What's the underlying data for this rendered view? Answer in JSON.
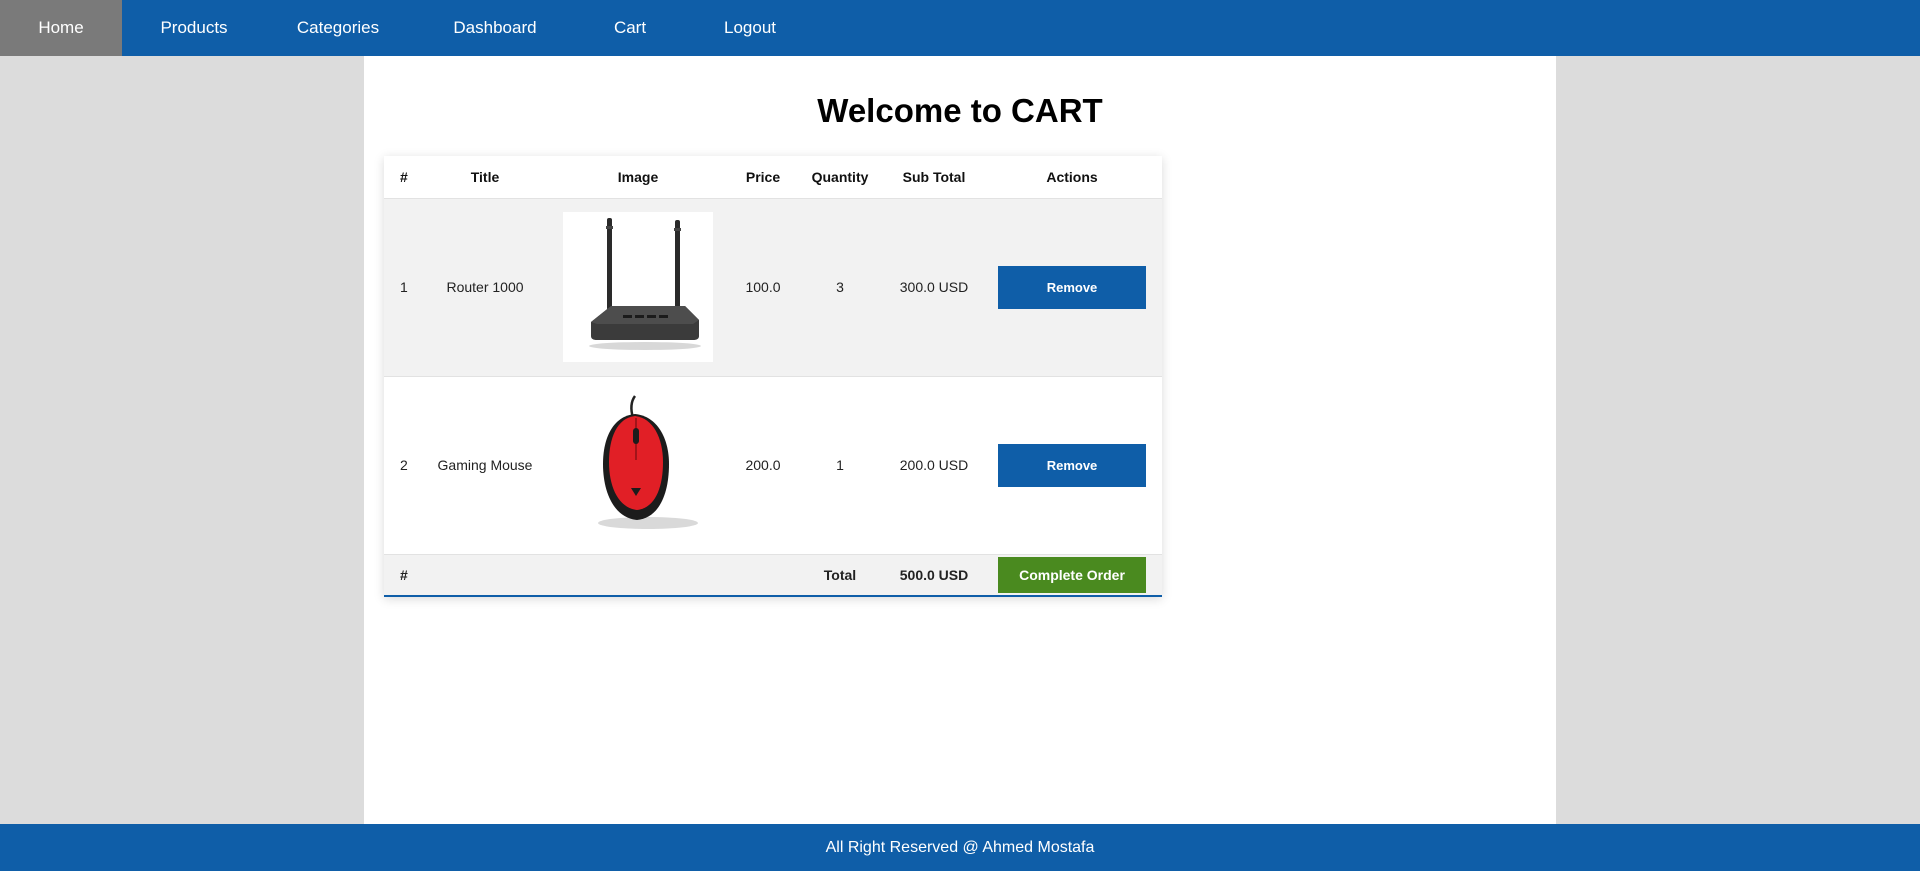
{
  "nav": {
    "items": [
      {
        "label": "Home",
        "active": true
      },
      {
        "label": "Products",
        "active": false
      },
      {
        "label": "Categories",
        "active": false
      },
      {
        "label": "Dashboard",
        "active": false
      },
      {
        "label": "Cart",
        "active": false
      },
      {
        "label": "Logout",
        "active": false
      }
    ]
  },
  "page": {
    "title": "Welcome to CART"
  },
  "cart": {
    "headers": [
      "#",
      "Title",
      "Image",
      "Price",
      "Quantity",
      "Sub Total",
      "Actions"
    ],
    "rows": [
      {
        "index": "1",
        "title": "Router 1000",
        "image": "router-image",
        "price": "100.0",
        "quantity": "3",
        "subtotal": "300.0 USD",
        "action_label": "Remove"
      },
      {
        "index": "2",
        "title": "Gaming Mouse",
        "image": "gaming-mouse-image",
        "price": "200.0",
        "quantity": "1",
        "subtotal": "200.0 USD",
        "action_label": "Remove"
      }
    ],
    "footer": {
      "index": "#",
      "total_label": "Total",
      "total_value": "500.0 USD",
      "complete_label": "Complete Order"
    }
  },
  "footer": {
    "text": "All Right Reserved @ Ahmed Mostafa"
  },
  "colors": {
    "primary": "#0f5ea8",
    "active_nav": "#7a7a7a",
    "success": "#4a8a1f",
    "page_bg": "#dcdcdc"
  }
}
